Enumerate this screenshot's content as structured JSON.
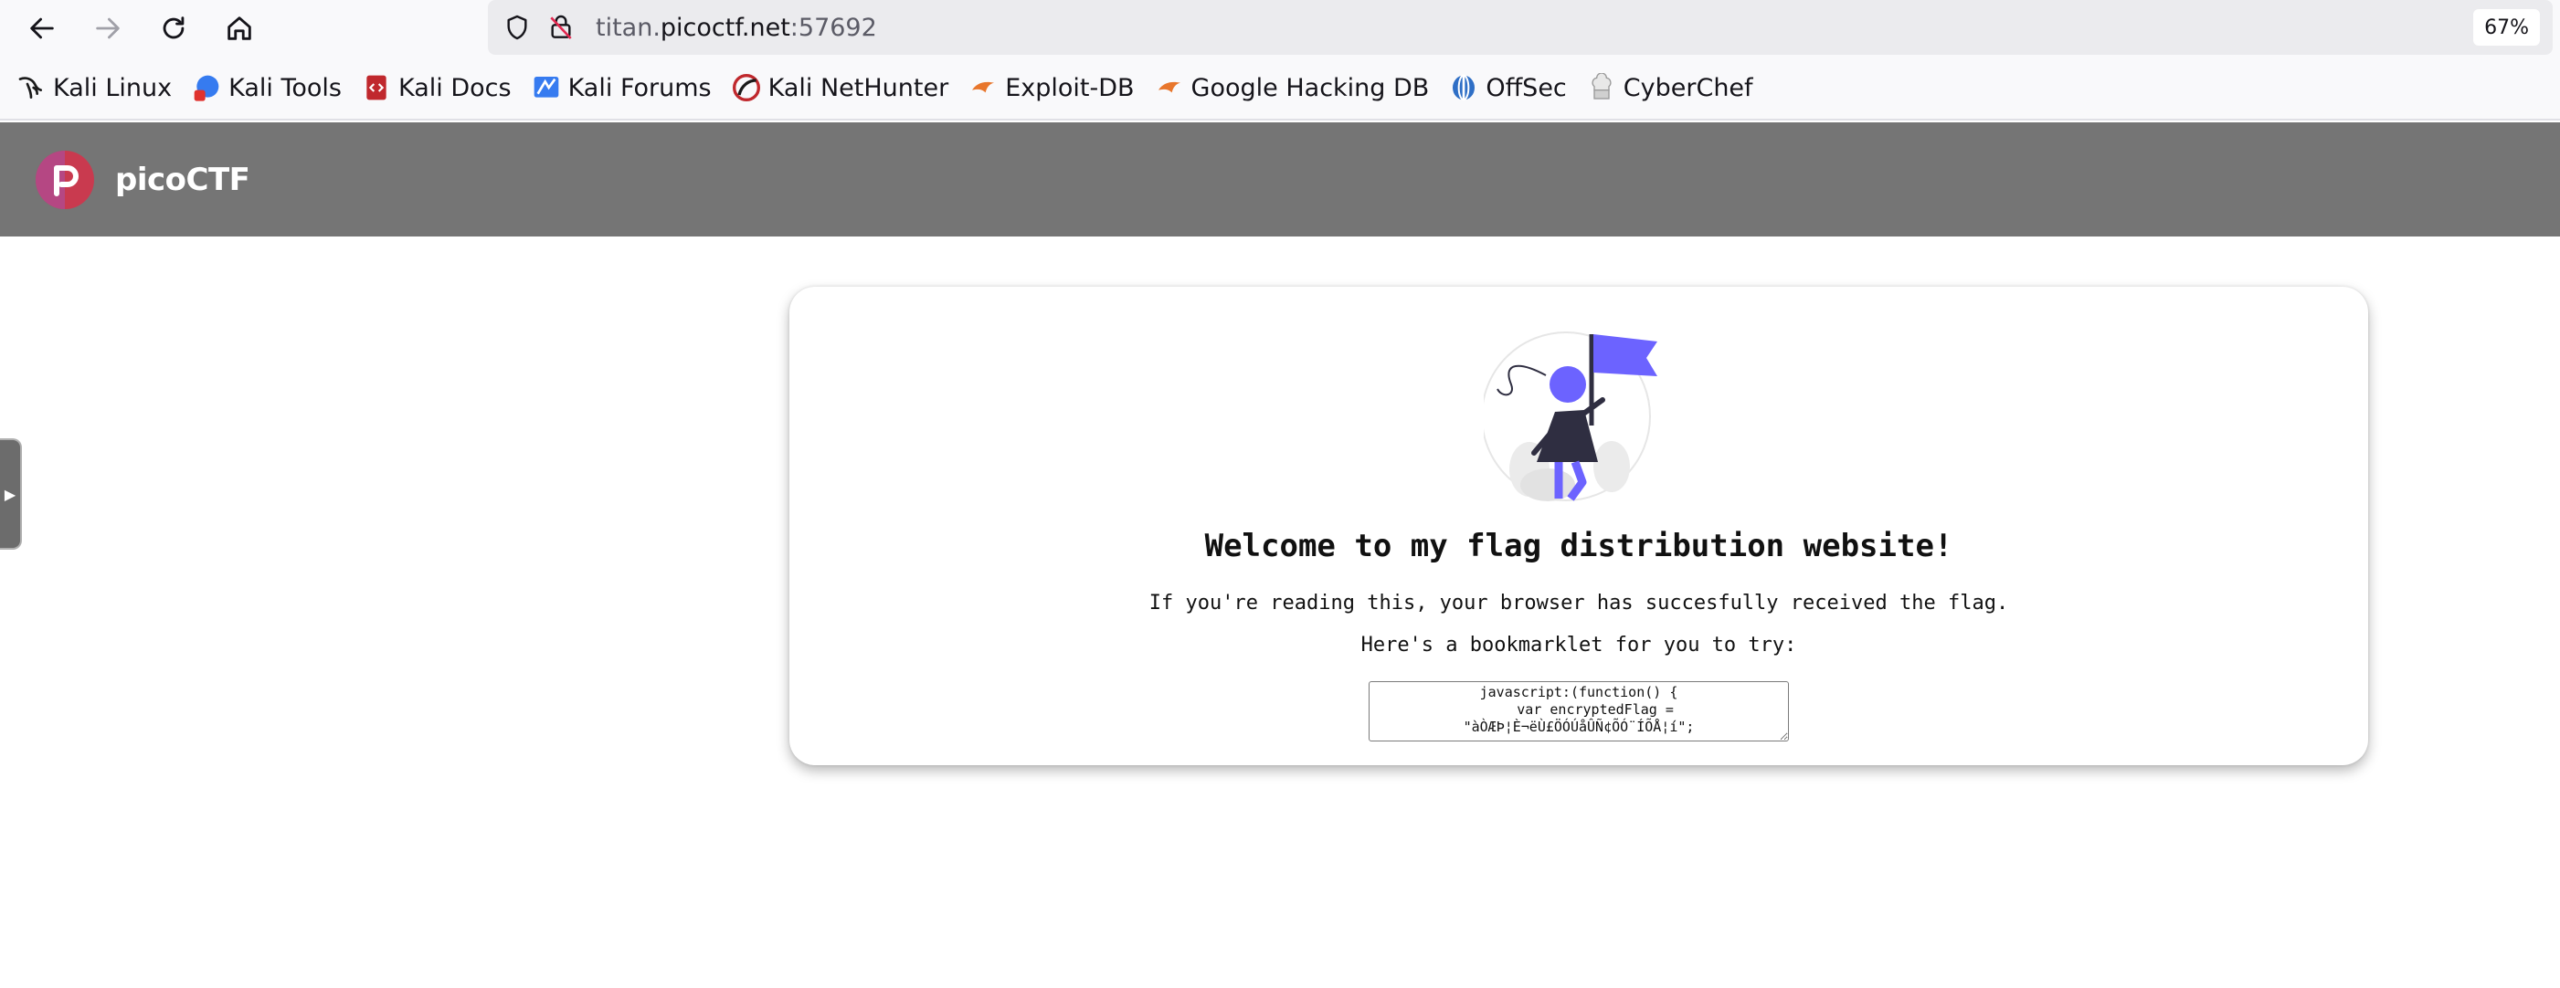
{
  "browser": {
    "url_prefix": "titan.",
    "url_domain": "picoctf.net",
    "url_suffix": ":57692",
    "zoom": "67%",
    "nav_icons": [
      "back-arrow-icon",
      "forward-arrow-icon",
      "reload-icon",
      "home-icon"
    ],
    "bookmarks": [
      {
        "label": "Kali Linux",
        "icon": "kali-dragon-icon"
      },
      {
        "label": "Kali Tools",
        "icon": "kali-tools-icon"
      },
      {
        "label": "Kali Docs",
        "icon": "kali-docs-icon"
      },
      {
        "label": "Kali Forums",
        "icon": "kali-forums-icon"
      },
      {
        "label": "Kali NetHunter",
        "icon": "kali-nethunter-icon"
      },
      {
        "label": "Exploit-DB",
        "icon": "exploit-db-icon"
      },
      {
        "label": "Google Hacking DB",
        "icon": "ghdb-icon"
      },
      {
        "label": "OffSec",
        "icon": "offsec-icon"
      },
      {
        "label": "CyberChef",
        "icon": "cyberchef-icon"
      }
    ]
  },
  "site": {
    "brand": "picoCTF",
    "heading": "Welcome to my flag distribution website!",
    "received_text": "If you're reading this, your browser has succesfully received the flag.",
    "try_text": "Here's a bookmarklet for you to try:",
    "bookmarklet_code": "javascript:(function() {\n    var encryptedFlag =\n\"àÒÆÞ¦È¬ëÙ£ÖÓÚåÛÑ¢ÕÓ¨ÍÕÅ¦í\";"
  },
  "colors": {
    "header_bg": "#757575",
    "accent": "#6c63ff",
    "logo": "#c93a4f"
  }
}
